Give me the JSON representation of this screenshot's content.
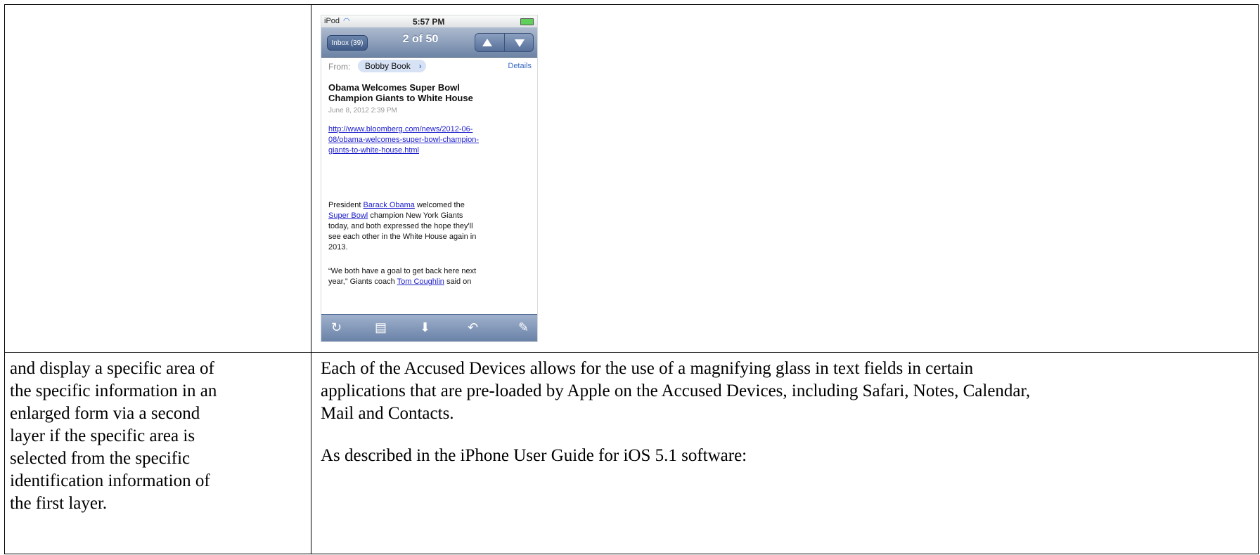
{
  "phone": {
    "status": {
      "carrier": "iPod",
      "time": "5:57 PM"
    },
    "nav": {
      "inbox_label": "Inbox (39)",
      "counter": "2 of 50"
    },
    "from_label": "From:",
    "from_name": "Bobby Book",
    "details_label": "Details",
    "subject_line1": "Obama Welcomes Super Bowl",
    "subject_line2": "Champion Giants to White House",
    "date": "June 8, 2012 2:39 PM",
    "link_line1": "http://www.bloomberg.com/news/2012-06-",
    "link_line2": "08/obama-welcomes-super-bowl-champion-",
    "link_line3": "giants-to-white-house.html",
    "p1_a": "President ",
    "p1_link1": "Barack Obama",
    "p1_b": " welcomed the",
    "p1_link2": "Super Bowl",
    "p1_c": " champion New York Giants",
    "p1_line3": "today, and both expressed the hope they'll",
    "p1_line4": "see each other in the White House again in",
    "p1_line5": "2013.",
    "p2_line1": "“We both have a goal to get back here next",
    "p2_a": "year,” Giants coach ",
    "p2_link": "Tom Coughlin",
    "p2_b": " said on",
    "toolbar_icons": [
      "refresh-icon",
      "folder-icon",
      "move-icon",
      "reply-icon",
      "compose-icon"
    ]
  },
  "left_cell": [
    "and display a specific area of",
    "the specific information in an",
    "enlarged form via a second",
    "layer if the specific area is",
    "selected from the specific",
    "identification information of",
    "the first layer."
  ],
  "right_cell": {
    "para1_line1": "Each of the Accused Devices allows for the use of a magnifying glass in text fields in certain",
    "para1_line2": "applications that are pre-loaded by Apple on the Accused Devices, including Safari, Notes, Calendar,",
    "para1_line3": "Mail and Contacts.",
    "para2": "As described in the iPhone User Guide for iOS 5.1 software:"
  }
}
